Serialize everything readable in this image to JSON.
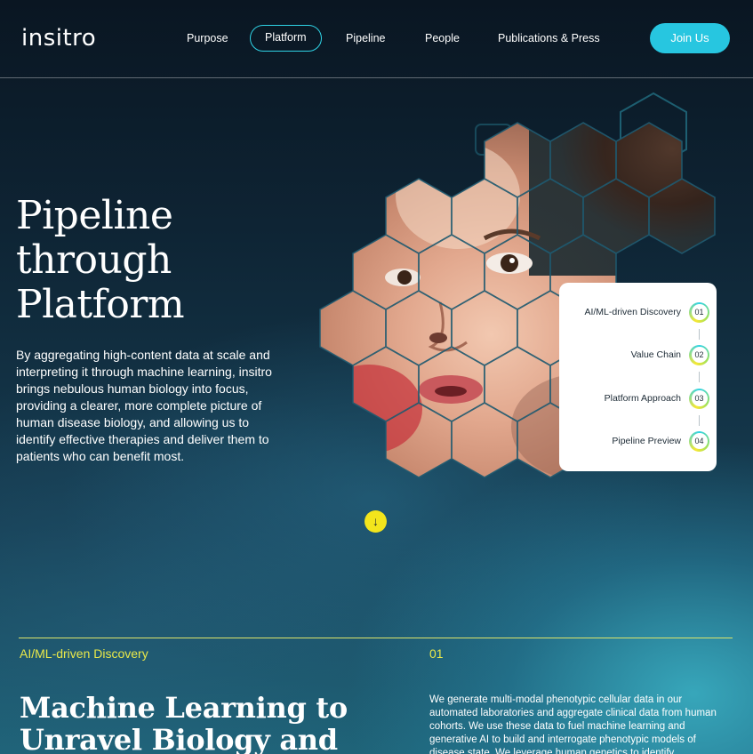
{
  "header": {
    "logo_text": "insitro",
    "nav": [
      {
        "label": "Purpose"
      },
      {
        "label": "Platform"
      },
      {
        "label": "Pipeline"
      },
      {
        "label": "People"
      },
      {
        "label": "Publications & Press"
      }
    ],
    "active_nav": "Platform",
    "join_label": "Join Us"
  },
  "hero": {
    "title": "Pipeline through Platform",
    "description": "By aggregating high-content data at scale and interpreting it through machine learning, insitro brings nebulous human biology into focus, providing a clearer, more complete picture of human disease biology, and allowing us to identify effective therapies and deliver them to patients who can benefit most."
  },
  "steps": [
    {
      "label": "AI/ML-driven Discovery",
      "number": "01"
    },
    {
      "label": "Value Chain",
      "number": "02"
    },
    {
      "label": "Platform Approach",
      "number": "03"
    },
    {
      "label": "Pipeline Preview",
      "number": "04"
    }
  ],
  "scroll": {
    "icon": "arrow-down-icon",
    "glyph": "↓"
  },
  "section": {
    "label": "AI/ML-driven Discovery",
    "number": "01",
    "heading": "Machine Learning to Unravel Biology and",
    "body": "We generate multi-modal phenotypic cellular data in our automated laboratories and aggregate clinical data from human cohorts. We use these data to fuel machine learning and generative AI to build and interrogate phenotypic models of disease state. We leverage human genetics to identify"
  },
  "colors": {
    "accent_cyan": "#27c6e0",
    "accent_yellow": "#f3e51c",
    "section_yellow": "#e9e84a",
    "card_text": "#1d2b36"
  }
}
